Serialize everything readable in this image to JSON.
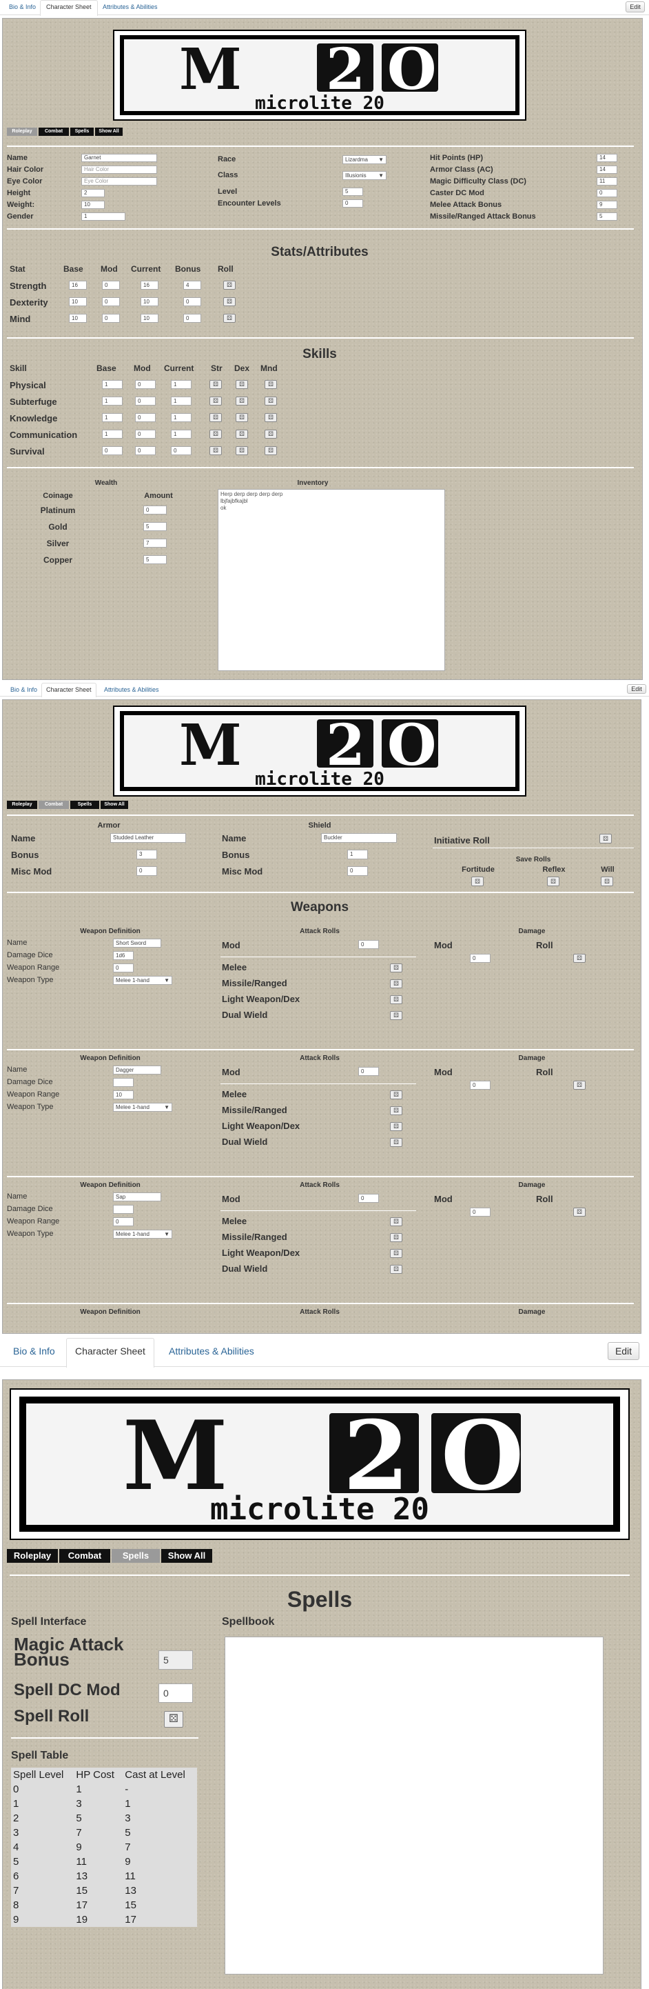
{
  "tabs": {
    "bio": "Bio & Info",
    "sheet": "Character Sheet",
    "attrs": "Attributes & Abilities",
    "edit": "Edit"
  },
  "logo": {
    "big": "M",
    "two": "2",
    "zero": "O",
    "small": "microlite 20"
  },
  "nav": {
    "roleplay": "Roleplay",
    "combat": "Combat",
    "spells": "Spells",
    "showall": "Show All"
  },
  "bio": {
    "name_label": "Name",
    "name": "Garnet",
    "hair_label": "Hair Color",
    "hair_ph": "Hair Color",
    "eye_label": "Eye Color",
    "eye_ph": "Eye Color",
    "height_label": "Height",
    "height": "2",
    "weight_label": "Weight:",
    "weight": "10",
    "gender_label": "Gender",
    "gender": "1",
    "race_label": "Race",
    "race": "Lizardma",
    "class_label": "Class",
    "class": "Illusionis",
    "level_label": "Level",
    "level": "5",
    "enc_label": "Encounter Levels",
    "enc": "0",
    "hp_label": "Hit Points (HP)",
    "hp": "14",
    "ac_label": "Armor Class (AC)",
    "ac": "14",
    "mdc_label": "Magic Difficulty Class (DC)",
    "mdc": "11",
    "cdc_label": "Caster DC Mod",
    "cdc": "0",
    "melee_label": "Melee Attack Bonus",
    "melee": "9",
    "missile_label": "Missile/Ranged Attack Bonus",
    "missile": "5"
  },
  "stats": {
    "title": "Stats/Attributes",
    "headers": [
      "Stat",
      "Base",
      "Mod",
      "Current",
      "Bonus",
      "Roll"
    ],
    "rows": [
      {
        "name": "Strength",
        "base": "16",
        "mod": "0",
        "current": "16",
        "bonus": "4"
      },
      {
        "name": "Dexterity",
        "base": "10",
        "mod": "0",
        "current": "10",
        "bonus": "0"
      },
      {
        "name": "Mind",
        "base": "10",
        "mod": "0",
        "current": "10",
        "bonus": "0"
      }
    ]
  },
  "skills": {
    "title": "Skills",
    "headers": [
      "Skill",
      "Base",
      "Mod",
      "Current",
      "Str",
      "Dex",
      "Mnd"
    ],
    "rows": [
      {
        "name": "Physical",
        "base": "1",
        "mod": "0",
        "current": "1"
      },
      {
        "name": "Subterfuge",
        "base": "1",
        "mod": "0",
        "current": "1"
      },
      {
        "name": "Knowledge",
        "base": "1",
        "mod": "0",
        "current": "1"
      },
      {
        "name": "Communication",
        "base": "1",
        "mod": "0",
        "current": "1"
      },
      {
        "name": "Survival",
        "base": "0",
        "mod": "0",
        "current": "0"
      }
    ]
  },
  "wealth": {
    "title": "Wealth",
    "coinage": "Coinage",
    "amount": "Amount",
    "rows": [
      {
        "name": "Platinum",
        "value": "0"
      },
      {
        "name": "Gold",
        "value": "5"
      },
      {
        "name": "Silver",
        "value": "7"
      },
      {
        "name": "Copper",
        "value": "5"
      }
    ],
    "inventory_label": "Inventory",
    "inventory": "Herp derp derp derp derp\nlbjfajbfkajbl\nok"
  },
  "armor": {
    "armor_title": "Armor",
    "shield_title": "Shield",
    "name_label": "Name",
    "bonus_label": "Bonus",
    "misc_label": "Misc Mod",
    "armor_name": "Studded Leather",
    "armor_bonus": "3",
    "armor_misc": "0",
    "shield_name": "Buckler",
    "shield_bonus": "1",
    "shield_misc": "0",
    "init_label": "Initiative Roll",
    "saves_label": "Save Rolls",
    "fort": "Fortitude",
    "reflex": "Reflex",
    "will": "Will"
  },
  "weapons": {
    "title": "Weapons",
    "def_label": "Weapon Definition",
    "attack_label": "Attack Rolls",
    "damage_label": "Damage",
    "name_label": "Name",
    "dice_label": "Damage Dice",
    "range_label": "Weapon Range",
    "type_label": "Weapon Type",
    "mod_label": "Mod",
    "roll_label": "Roll",
    "melee": "Melee",
    "missile": "Missile/Ranged",
    "light": "Light Weapon/Dex",
    "dual": "Dual Wield",
    "list": [
      {
        "name": "Short Sword",
        "dice": "1d6",
        "range": "0",
        "type": "Melee 1-hand",
        "mod": "0",
        "dmg_mod": "0"
      },
      {
        "name": "Dagger",
        "dice": "",
        "range": "10",
        "type": "Melee 1-hand",
        "mod": "0",
        "dmg_mod": "0"
      },
      {
        "name": "Sap",
        "dice": "",
        "range": "0",
        "type": "Melee 1-hand",
        "mod": "0",
        "dmg_mod": "0"
      }
    ]
  },
  "spells": {
    "title": "Spells",
    "interface": "Spell Interface",
    "spellbook": "Spellbook",
    "mab_label": "Magic Attack Bonus",
    "mab": "5",
    "dc_label": "Spell DC Mod",
    "dc": "0",
    "roll_label": "Spell Roll",
    "table_label": "Spell Table",
    "table_headers": [
      "Spell Level",
      "HP Cost",
      "Cast at Level"
    ],
    "table_rows": [
      [
        "0",
        "1",
        "-"
      ],
      [
        "1",
        "3",
        "1"
      ],
      [
        "2",
        "5",
        "3"
      ],
      [
        "3",
        "7",
        "5"
      ],
      [
        "4",
        "9",
        "7"
      ],
      [
        "5",
        "11",
        "9"
      ],
      [
        "6",
        "13",
        "11"
      ],
      [
        "7",
        "15",
        "13"
      ],
      [
        "8",
        "17",
        "15"
      ],
      [
        "9",
        "19",
        "17"
      ]
    ]
  }
}
